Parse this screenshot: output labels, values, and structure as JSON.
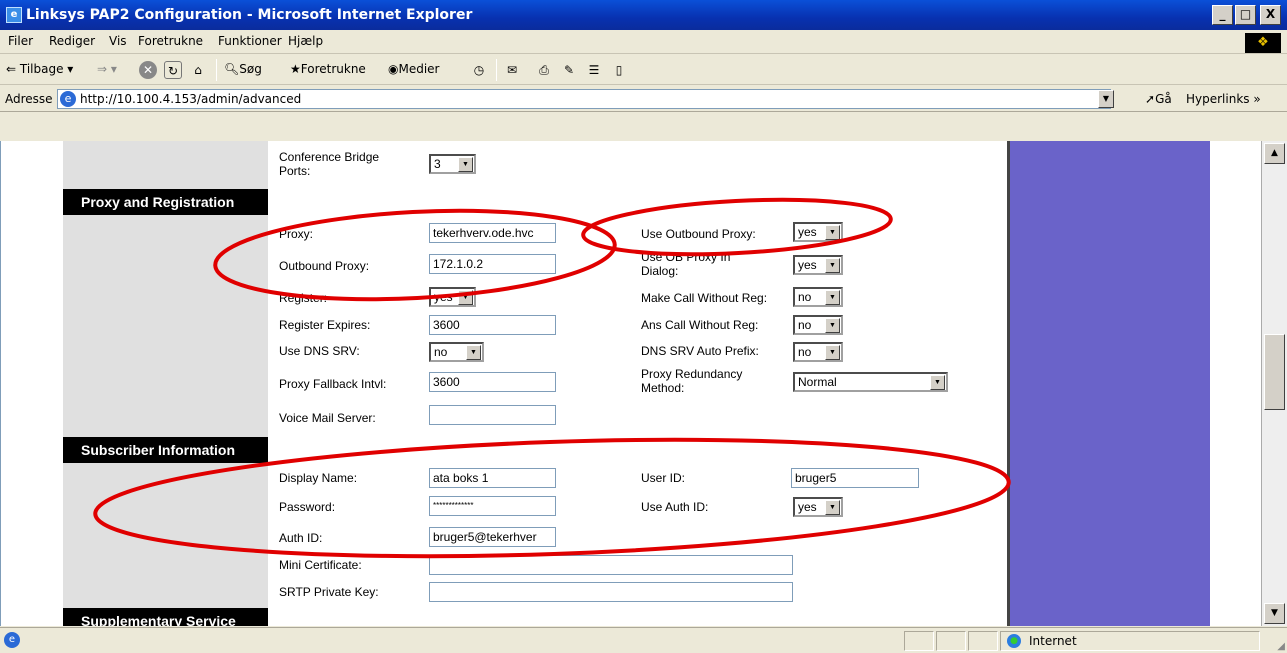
{
  "window": {
    "title": "Linksys PAP2 Configuration - Microsoft Internet Explorer",
    "min": "_",
    "max": "□",
    "close": "X"
  },
  "menu": [
    "Filer",
    "Rediger",
    "Vis",
    "Foretrukne",
    "Funktioner",
    "Hjælp"
  ],
  "toolbar": {
    "back": "Tilbage",
    "search": "Søg",
    "favorites": "Foretrukne",
    "media": "Medier"
  },
  "address": {
    "label": "Adresse",
    "url": "http://10.100.4.153/admin/advanced",
    "go": "Gå",
    "links": "Hyperlinks »"
  },
  "form": {
    "conference_label": "Conference Bridge\nPorts:",
    "conference_value": "3",
    "section_proxy": "Proxy and Registration",
    "proxy_label": "Proxy:",
    "proxy_value": "tekerhverv.ode.hvc",
    "outbound_proxy_label": "Outbound Proxy:",
    "outbound_proxy_value": "172.1.0.2",
    "register_label": "Register:",
    "register_value": "yes",
    "register_expires_label": "Register Expires:",
    "register_expires_value": "3600",
    "use_dns_srv_label": "Use DNS SRV:",
    "use_dns_srv_value": "no",
    "proxy_fallback_label": "Proxy Fallback Intvl:",
    "proxy_fallback_value": "3600",
    "voice_mail_label": "Voice Mail Server:",
    "voice_mail_value": "",
    "use_outbound_proxy_label": "Use Outbound Proxy:",
    "use_outbound_proxy_value": "yes",
    "use_ob_proxy_dialog_label": "Use OB Proxy In\nDialog:",
    "use_ob_proxy_dialog_value": "yes",
    "make_call_label": "Make Call Without Reg:",
    "make_call_value": "no",
    "ans_call_label": "Ans Call Without Reg:",
    "ans_call_value": "no",
    "dns_srv_prefix_label": "DNS SRV Auto Prefix:",
    "dns_srv_prefix_value": "no",
    "proxy_redundancy_label": "Proxy Redundancy\nMethod:",
    "proxy_redundancy_value": "Normal",
    "section_subscriber": "Subscriber Information",
    "display_name_label": "Display Name:",
    "display_name_value": "ata boks 1",
    "password_label": "Password:",
    "password_value": "*************",
    "auth_id_label": "Auth ID:",
    "auth_id_value": "bruger5@tekerhver",
    "mini_cert_label": "Mini Certificate:",
    "mini_cert_value": "",
    "srtp_label": "SRTP Private Key:",
    "srtp_value": "",
    "user_id_label": "User ID:",
    "user_id_value": "bruger5",
    "use_auth_id_label": "Use Auth ID:",
    "use_auth_id_value": "yes",
    "section_supplementary": "Supplementary Service"
  },
  "status": {
    "zone": "Internet"
  },
  "colors": {
    "annotation": "#e00000",
    "sidebar": "#6a63c9"
  }
}
